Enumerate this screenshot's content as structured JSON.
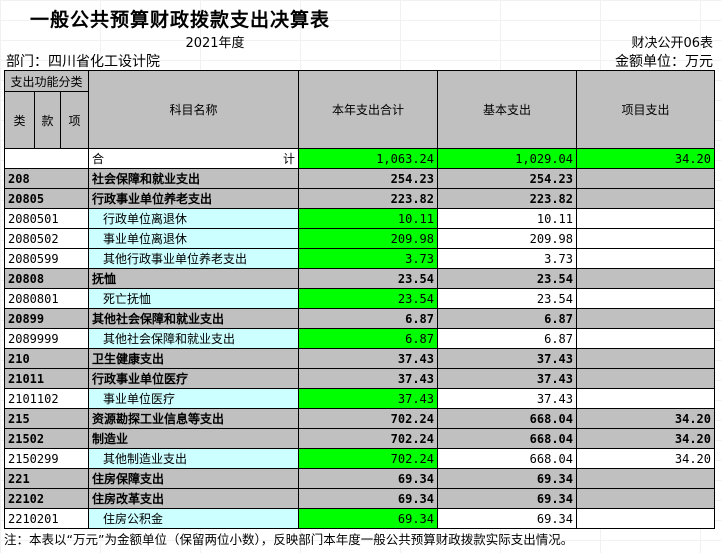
{
  "title": "一般公共预算财政拨款支出决算表",
  "year": "2021年度",
  "form_no": "财决公开06表",
  "department": "部门：四川省化工设计院",
  "unit": "金额单位：万元",
  "header": {
    "func_class": "支出功能分类",
    "lei": "类",
    "kuan": "款",
    "xiang": "项",
    "subject": "科目名称",
    "total": "本年支出合计",
    "basic": "基本支出",
    "project": "项目支出"
  },
  "total_row": {
    "label_left": "合",
    "label_right": "计",
    "total": "1,063.24",
    "basic": "1,029.04",
    "project": "34.20"
  },
  "rows": [
    {
      "code": "208",
      "name": "社会保障和就业支出",
      "total": "254.23",
      "basic": "254.23",
      "project": "",
      "level": "bold"
    },
    {
      "code": "20805",
      "name": "行政事业单位养老支出",
      "total": "223.82",
      "basic": "223.82",
      "project": "",
      "level": "bold"
    },
    {
      "code": "2080501",
      "name": "行政单位离退休",
      "total": "10.11",
      "basic": "10.11",
      "project": "",
      "level": "sub"
    },
    {
      "code": "2080502",
      "name": "事业单位离退休",
      "total": "209.98",
      "basic": "209.98",
      "project": "",
      "level": "sub"
    },
    {
      "code": "2080599",
      "name": "其他行政事业单位养老支出",
      "total": "3.73",
      "basic": "3.73",
      "project": "",
      "level": "sub"
    },
    {
      "code": "20808",
      "name": "抚恤",
      "total": "23.54",
      "basic": "23.54",
      "project": "",
      "level": "bold"
    },
    {
      "code": "2080801",
      "name": "死亡抚恤",
      "total": "23.54",
      "basic": "23.54",
      "project": "",
      "level": "sub"
    },
    {
      "code": "20899",
      "name": "其他社会保障和就业支出",
      "total": "6.87",
      "basic": "6.87",
      "project": "",
      "level": "bold"
    },
    {
      "code": "2089999",
      "name": "其他社会保障和就业支出",
      "total": "6.87",
      "basic": "6.87",
      "project": "",
      "level": "sub"
    },
    {
      "code": "210",
      "name": "卫生健康支出",
      "total": "37.43",
      "basic": "37.43",
      "project": "",
      "level": "bold"
    },
    {
      "code": "21011",
      "name": "行政事业单位医疗",
      "total": "37.43",
      "basic": "37.43",
      "project": "",
      "level": "bold"
    },
    {
      "code": "2101102",
      "name": "事业单位医疗",
      "total": "37.43",
      "basic": "37.43",
      "project": "",
      "level": "sub"
    },
    {
      "code": "215",
      "name": "资源勘探工业信息等支出",
      "total": "702.24",
      "basic": "668.04",
      "project": "34.20",
      "level": "bold"
    },
    {
      "code": "21502",
      "name": "制造业",
      "total": "702.24",
      "basic": "668.04",
      "project": "34.20",
      "level": "bold"
    },
    {
      "code": "2150299",
      "name": "其他制造业支出",
      "total": "702.24",
      "basic": "668.04",
      "project": "34.20",
      "level": "sub"
    },
    {
      "code": "221",
      "name": "住房保障支出",
      "total": "69.34",
      "basic": "69.34",
      "project": "",
      "level": "bold"
    },
    {
      "code": "22102",
      "name": "住房改革支出",
      "total": "69.34",
      "basic": "69.34",
      "project": "",
      "level": "bold"
    },
    {
      "code": "2210201",
      "name": "住房公积金",
      "total": "69.34",
      "basic": "69.34",
      "project": "",
      "level": "sub"
    }
  ],
  "note": "注：本表以“万元”为金额单位（保留两位小数），反映部门本年度一般公共预算财政拨款实际支出情况。",
  "colors": {
    "header_gray": "#c0c0c0",
    "green": "#00ff00",
    "cyan": "#ccffff"
  }
}
